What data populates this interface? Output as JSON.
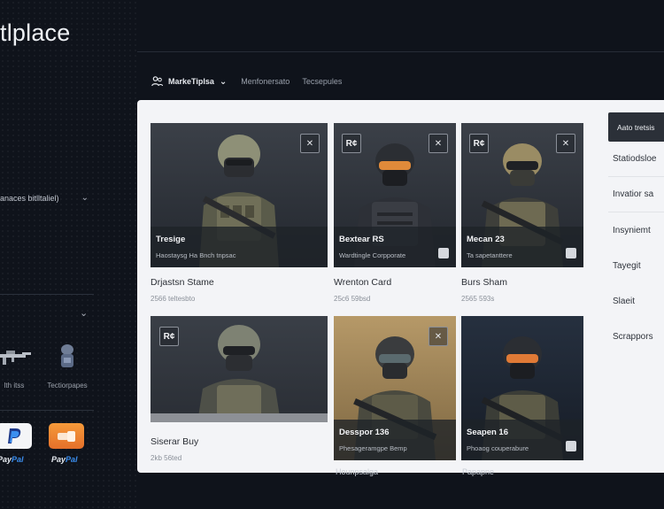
{
  "sidebar": {
    "brand_title": "tlplace",
    "filter_label": "anaces bitlltaliel)",
    "items": [
      {
        "label": "lth itss",
        "icon": "rifle-icon"
      },
      {
        "label": "Tectiorpapes",
        "icon": "armor-icon"
      }
    ],
    "payments": [
      {
        "label_a": "Pay",
        "label_b": "Pal",
        "icon": "paypal-icon"
      },
      {
        "label_a": "Pay",
        "label_b": "Pal",
        "icon": "paypal-orange-icon"
      }
    ]
  },
  "nav": {
    "home": "MarkeTiplsa",
    "item2": "Menfonersato",
    "item3": "Tecsepules"
  },
  "cards": [
    {
      "title": "Drjastsn Stame",
      "price": "2566 teltesbto",
      "overlay_name": "Tresige",
      "overlay_sub": "Haostaysg Ha Bnch tnpsac",
      "badge_r": "",
      "theme": "gray"
    },
    {
      "title": "Wrenton Card",
      "price": "25c6 59bsd",
      "overlay_name": "Bextear RS",
      "overlay_sub": "Wardtingle Corpporate",
      "badge_r": "R¢",
      "theme": "gray"
    },
    {
      "title": "Burs Sham",
      "price": "2565 593s",
      "overlay_name": "Mecan 23",
      "overlay_sub": "Ta sapetanttere",
      "badge_r": "R¢",
      "theme": "gray"
    },
    {
      "title": "Siserar Buy",
      "price": "2kb 56ted",
      "overlay_name": "",
      "overlay_sub": "",
      "badge_r": "R¢",
      "theme": "gray"
    },
    {
      "title": "",
      "price": "",
      "overlay_name": "Desspor 136",
      "overlay_sub": "Phesageramgpe Bemp",
      "badge_r": "",
      "theme": "tan"
    },
    {
      "title": "",
      "price": "",
      "overlay_name": "Seapen 16",
      "overlay_sub": "Phoaog couperabure",
      "badge_r": "",
      "theme": "navy"
    }
  ],
  "right_menu": {
    "button": "Aato tretsis",
    "items": [
      "Statiodsloe",
      "Invatior sa",
      "Insyniemt",
      "Tayegit",
      "Slaeit",
      "Scrappors"
    ]
  },
  "bottom_peek": [
    "Hounpsalga",
    "Papapne"
  ]
}
